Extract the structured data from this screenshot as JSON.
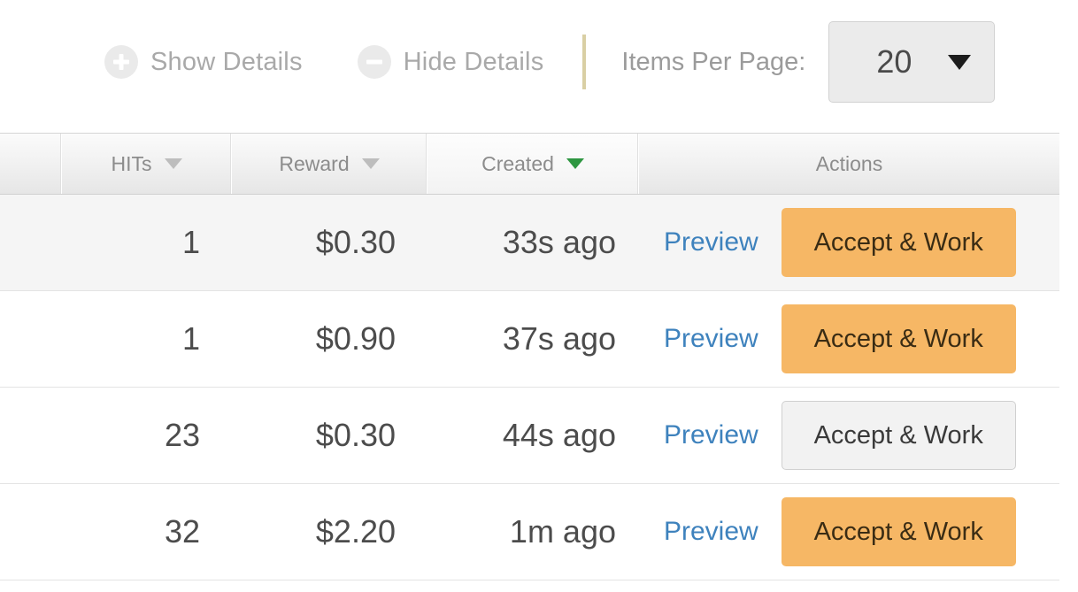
{
  "toolbar": {
    "show_details_label": "Show Details",
    "hide_details_label": "Hide Details",
    "items_per_page_label": "Items Per Page:",
    "items_per_page_value": "20",
    "show_details_icon": "plus-circle-icon",
    "hide_details_icon": "minus-circle-icon",
    "divider_color": "#d9cfa4"
  },
  "table": {
    "columns": [
      {
        "key": "blank",
        "label": "",
        "sortable": false,
        "sorted": false
      },
      {
        "key": "hits",
        "label": "HITs",
        "sortable": true,
        "sorted": false
      },
      {
        "key": "reward",
        "label": "Reward",
        "sortable": true,
        "sorted": false
      },
      {
        "key": "created",
        "label": "Created",
        "sortable": true,
        "sorted": true
      },
      {
        "key": "actions",
        "label": "Actions",
        "sortable": false,
        "sorted": false
      }
    ],
    "rows": [
      {
        "hits": "1",
        "reward": "$0.30",
        "created": "33s ago",
        "preview_label": "Preview",
        "accept_label": "Accept & Work",
        "accept_style": "primary",
        "row_style": "alt"
      },
      {
        "hits": "1",
        "reward": "$0.90",
        "created": "37s ago",
        "preview_label": "Preview",
        "accept_label": "Accept & Work",
        "accept_style": "primary",
        "row_style": "normal"
      },
      {
        "hits": "23",
        "reward": "$0.30",
        "created": "44s ago",
        "preview_label": "Preview",
        "accept_label": "Accept & Work",
        "accept_style": "secondary",
        "row_style": "normal"
      },
      {
        "hits": "32",
        "reward": "$2.20",
        "created": "1m ago",
        "preview_label": "Preview",
        "accept_label": "Accept & Work",
        "accept_style": "primary",
        "row_style": "normal"
      }
    ]
  },
  "colors": {
    "accept_primary": "#f6b765",
    "accept_primary_text": "#3a2c14",
    "link": "#3e82bd",
    "sort_active": "#2e9641",
    "sort_inactive": "#bdbdbd"
  }
}
